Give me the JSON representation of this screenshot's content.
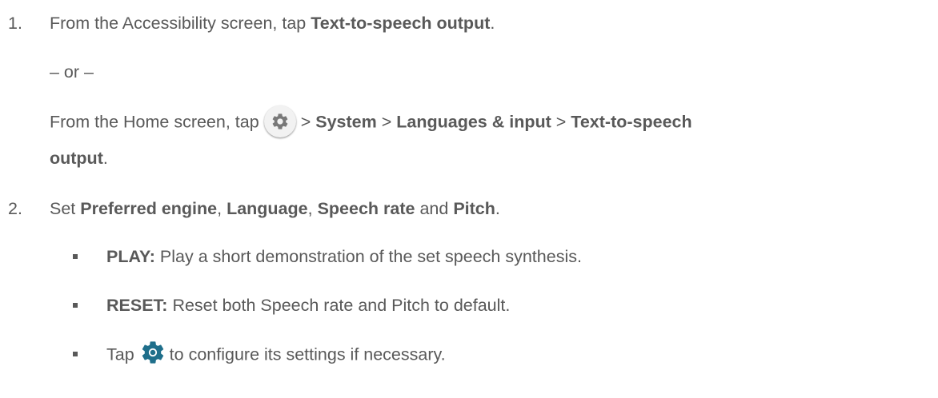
{
  "steps": [
    {
      "number": "1.",
      "main": {
        "prefix": "From the Accessibility screen, tap ",
        "bold": "Text-to-speech output",
        "suffix": "."
      },
      "or": "– or –",
      "alt": {
        "prefix": "From the Home screen, tap",
        "sep1": ">",
        "item1": "System",
        "sep2": ">",
        "item2": "Languages & input",
        "sep3": ">",
        "item3a": "Text-to-speech",
        "item3b": "output",
        "suffix": "."
      }
    },
    {
      "number": "2.",
      "main": {
        "prefix": "Set ",
        "b1": "Preferred engine",
        "c1": ", ",
        "b2": "Language",
        "c2": ", ",
        "b3": "Speech rate",
        "and": " and ",
        "b4": "Pitch",
        "suffix": "."
      },
      "bullets": [
        {
          "bold": "PLAY:",
          "text": " Play a short demonstration of the set speech synthesis."
        },
        {
          "bold": "RESET:",
          "text": " Reset both Speech rate and Pitch to default."
        },
        {
          "pre": "Tap",
          "post": "to configure its settings if necessary."
        }
      ]
    }
  ],
  "icons": {
    "settings_app": "gear-icon",
    "engine_settings": "gear-icon",
    "gray_gear_color": "#787878",
    "blue_gear_color": "#1f6f8b",
    "button_bg": "#f2f2f2"
  }
}
